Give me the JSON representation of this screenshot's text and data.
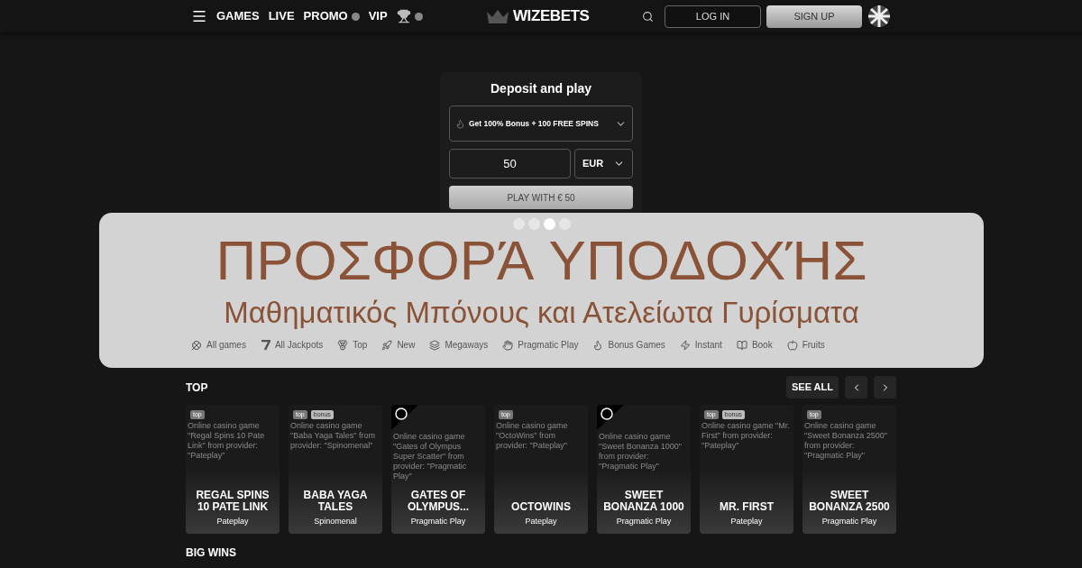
{
  "header": {
    "nav": [
      {
        "kind": "link",
        "label": "GAMES",
        "dot": false
      },
      {
        "kind": "link",
        "label": "LIVE",
        "dot": false
      },
      {
        "kind": "link",
        "label": "PROMO",
        "dot": true
      },
      {
        "kind": "link",
        "label": "VIP",
        "dot": false
      },
      {
        "kind": "trophy",
        "dot": true
      }
    ],
    "logo": "WIZEBETS",
    "login": "LOG IN",
    "signup": "SIGN UP"
  },
  "deposit": {
    "title": "Deposit and play",
    "bonus": "Get 100% Bonus + 100 FREE SPINS",
    "amount": "50",
    "currency": "EUR",
    "button": "PLAY WITH € 50"
  },
  "banner": {
    "title": "ΠΡΟΣΦΟΡΆ ΥΠΟΔΟΧΉΣ",
    "subtitle": "Μαθηματικός Μπόνους και Ατελείωτα Γυρίσματα",
    "carousel_dots": [
      {
        "selected": false
      },
      {
        "selected": false
      },
      {
        "selected": true
      },
      {
        "selected": false
      }
    ],
    "categories": [
      {
        "label": "All games"
      },
      {
        "label": "All Jackpots"
      },
      {
        "label": "Top"
      },
      {
        "label": "New"
      },
      {
        "label": "Megaways"
      },
      {
        "label": "Pragmatic Play"
      },
      {
        "label": "Bonus Games"
      },
      {
        "label": "Instant"
      },
      {
        "label": "Book"
      },
      {
        "label": "Fruits"
      }
    ]
  },
  "top": {
    "title": "TOP",
    "see_all": "SEE ALL",
    "games": [
      {
        "alt": "Online casino game \"Regal Spins 10 Pate Link\" from provider: \"Pateplay\"",
        "badges": [
          "top"
        ],
        "drops_wins": false,
        "title": "REGAL SPINS 10 PATE LINK",
        "provider": "Pateplay"
      },
      {
        "alt": "Online casino game \"Baba Yaga Tales\" from provider: \"Spinomenal\"",
        "badges": [
          "top",
          "bonus"
        ],
        "drops_wins": false,
        "title": "BABA YAGA TALES",
        "provider": "Spinomenal"
      },
      {
        "alt": "Online casino game \"Gates of Olympus Super Scatter\" from provider: \"Pragmatic Play\"",
        "drops_wins": true,
        "title": "GATES OF OLYMPUS...",
        "provider": "Pragmatic Play"
      },
      {
        "alt": "Online casino game \"OctoWins\" from provider: \"Pateplay\"",
        "badges": [
          "top"
        ],
        "drops_wins": false,
        "title": "OCTOWINS",
        "provider": "Pateplay"
      },
      {
        "alt": "Online casino game \"Sweet Bonanza 1000\" from provider: \"Pragmatic Play\"",
        "drops_wins": true,
        "title": "SWEET BONANZA 1000",
        "provider": "Pragmatic Play"
      },
      {
        "alt": "Online casino game \"Mr. First\" from provider: \"Pateplay\"",
        "badges": [
          "top",
          "bonus"
        ],
        "drops_wins": false,
        "title": "MR. FIRST",
        "provider": "Pateplay"
      },
      {
        "alt": "Online casino game \"Sweet Bonanza 2500\" from provider: \"Pragmatic Play\"",
        "badges": [
          "top"
        ],
        "drops_wins": false,
        "title": "SWEET BONANZA 2500",
        "provider": "Pragmatic Play"
      }
    ]
  },
  "big_wins": {
    "title": "BIG WINS"
  }
}
